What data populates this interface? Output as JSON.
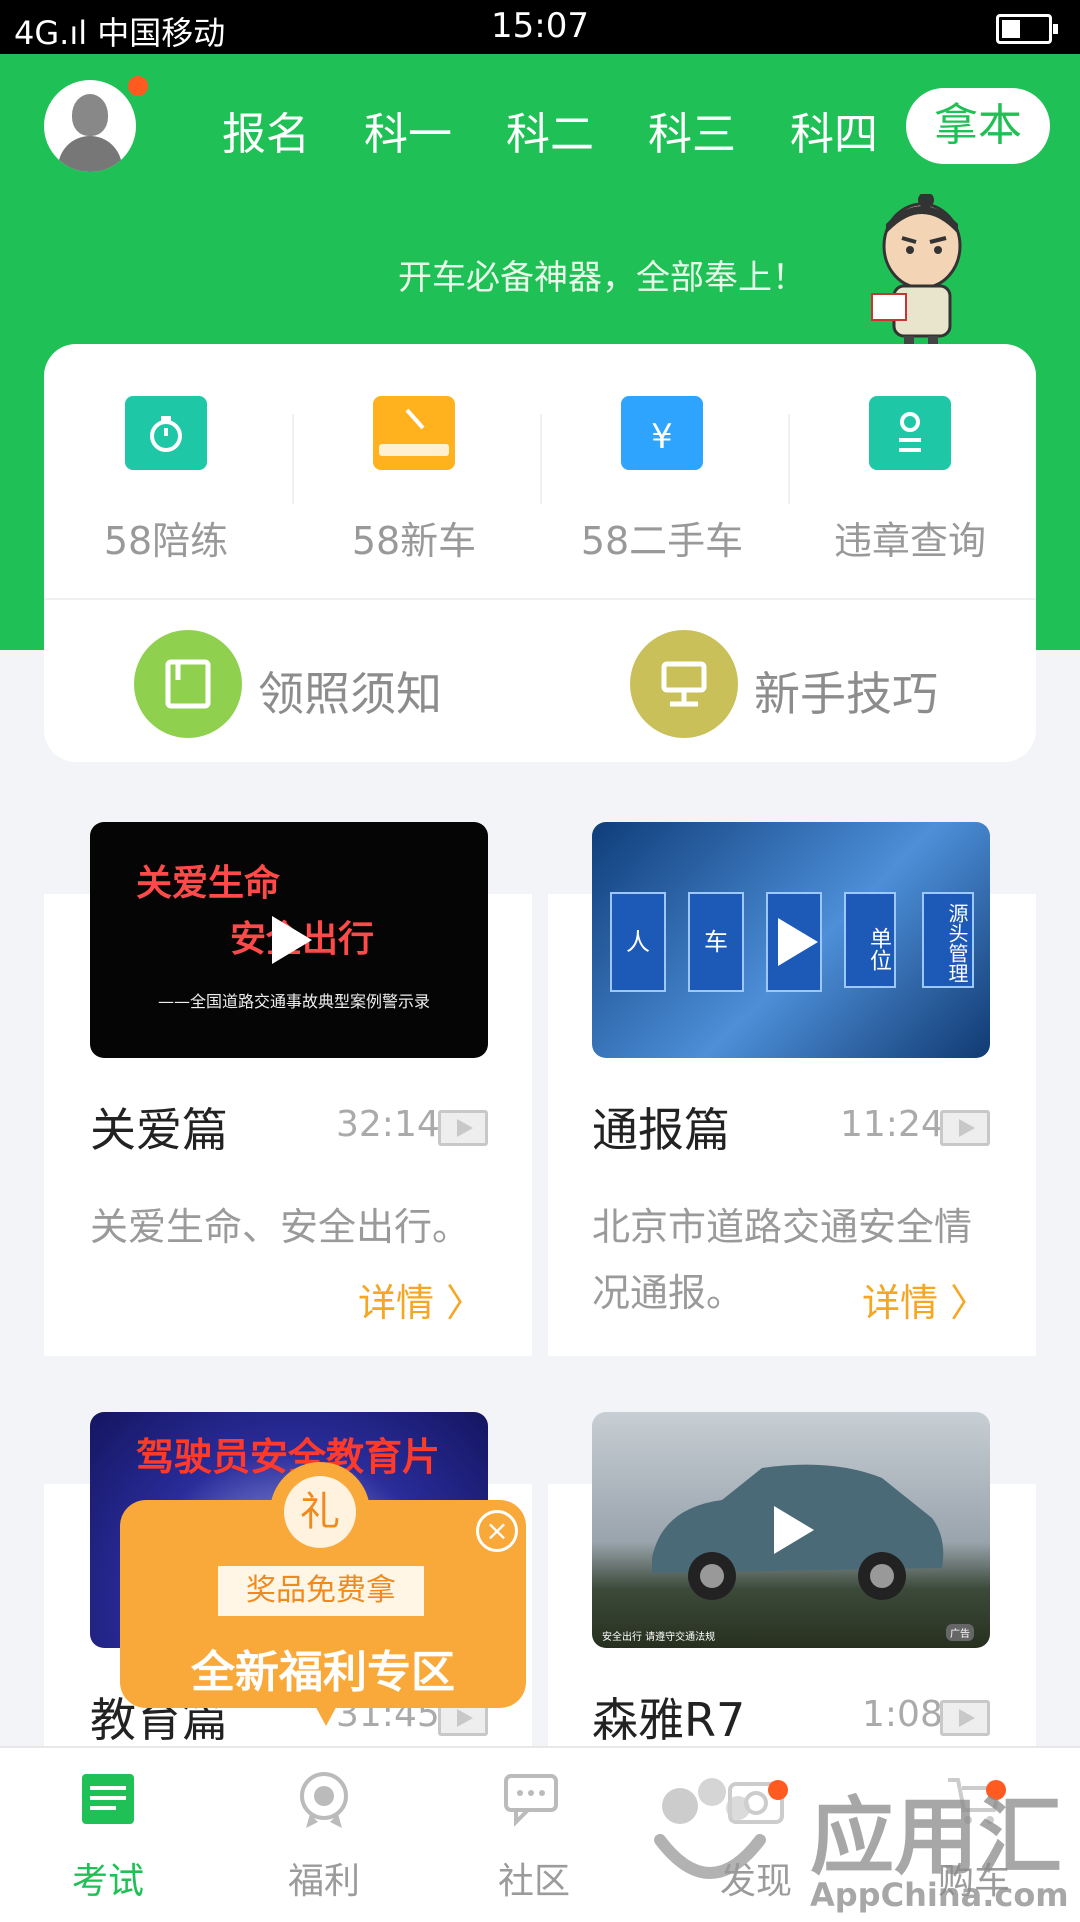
{
  "status_bar": {
    "signal": "4G.ıl",
    "carrier": "中国移动",
    "time": "15:07"
  },
  "header": {
    "tabs": [
      "报名",
      "科一",
      "科二",
      "科三",
      "科四"
    ],
    "active_button": "拿本",
    "slogan": "开车必备神器，全部奉上！",
    "brand_color": "#1fc055"
  },
  "services": [
    {
      "label": "58陪练",
      "icon": "stopwatch-icon",
      "color": "#1ec8a6"
    },
    {
      "label": "58新车",
      "icon": "car-icon",
      "color": "#ffb21e"
    },
    {
      "label": "58二手车",
      "icon": "yuan-icon",
      "color": "#2fa4ff"
    },
    {
      "label": "违章查询",
      "icon": "id-card-icon",
      "color": "#1ec8a6"
    }
  ],
  "guides": [
    {
      "label": "领照须知",
      "icon": "document-icon",
      "color": "#8fd14f"
    },
    {
      "label": "新手技巧",
      "icon": "monitor-icon",
      "color": "#c9c05a"
    }
  ],
  "videos": [
    {
      "title": "关爱篇",
      "duration": "32:14",
      "desc": "关爱生命、安全出行。",
      "more": "详情 〉",
      "thumb_text": [
        "关爱生命",
        "安全出行",
        "——全国道路交通事故典型案例警示录"
      ]
    },
    {
      "title": "通报篇",
      "duration": "11:24",
      "desc": "北京市道路交通安全情况通报。",
      "more": "详情 〉",
      "thumb_text": [
        "人",
        "车",
        "单位",
        "源头管理"
      ]
    },
    {
      "title": "教育篇",
      "duration": "31:45",
      "thumb_text": [
        "驾驶员安全教育片"
      ]
    },
    {
      "title": "森雅R7",
      "duration": "1:08",
      "thumb_text": [
        "安全出行 请遵守交通法规",
        "广告"
      ]
    }
  ],
  "popup": {
    "badge": "礼",
    "ribbon": "奖品免费拿",
    "title": "全新福利专区",
    "close": "×"
  },
  "bottom_nav": [
    {
      "label": "考试",
      "icon": "exam-icon",
      "active": true
    },
    {
      "label": "福利",
      "icon": "medal-icon",
      "active": false
    },
    {
      "label": "社区",
      "icon": "chat-icon",
      "active": false
    },
    {
      "label": "发现",
      "icon": "camera-icon",
      "active": false
    },
    {
      "label": "购车",
      "icon": "cart-icon",
      "active": false
    }
  ],
  "watermark": {
    "brand": "应用汇",
    "site": "AppChina.com"
  }
}
